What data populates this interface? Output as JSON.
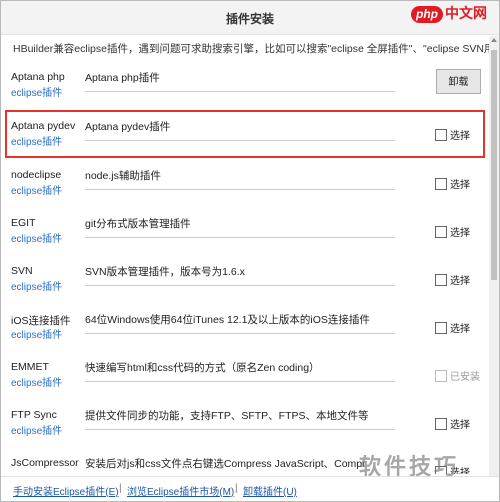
{
  "window": {
    "title": "插件安装"
  },
  "watermark_top": {
    "logo": "php",
    "text": "中文网"
  },
  "description": "HBuilder兼容eclipse插件，遇到问题可求助搜索引擎，比如可以搜索\"eclipse 全屏插件\"、\"eclipse SVN用法\"",
  "plugins": [
    {
      "name": "Aptana php",
      "link": "eclipse插件",
      "desc": "Aptana php插件",
      "action": "button",
      "action_label": "卸载"
    },
    {
      "name": "Aptana pydev",
      "link": "eclipse插件",
      "desc": "Aptana pydev插件",
      "action": "checkbox",
      "action_label": "选择",
      "highlighted": true
    },
    {
      "name": "nodeclipse",
      "link": "eclipse插件",
      "desc": "node.js辅助插件",
      "action": "checkbox",
      "action_label": "选择"
    },
    {
      "name": "EGIT",
      "link": "eclipse插件",
      "desc": "git分布式版本管理插件",
      "action": "checkbox",
      "action_label": "选择"
    },
    {
      "name": "SVN",
      "link": "eclipse插件",
      "desc": "SVN版本管理插件，版本号为1.6.x",
      "action": "checkbox",
      "action_label": "选择"
    },
    {
      "name": "iOS连接插件",
      "link": "eclipse插件",
      "desc": "64位Windows使用64位iTunes 12.1及以上版本的iOS连接插件",
      "action": "checkbox",
      "action_label": "选择"
    },
    {
      "name": "EMMET",
      "link": "eclipse插件",
      "desc": "快速编写html和css代码的方式（原名Zen coding）",
      "action": "checkbox-disabled",
      "action_label": "已安装"
    },
    {
      "name": "FTP Sync",
      "link": "eclipse插件",
      "desc": "提供文件同步的功能，支持FTP、SFTP、FTPS、本地文件等",
      "action": "checkbox",
      "action_label": "选择"
    },
    {
      "name": "JsCompressor",
      "link": "",
      "desc": "安装后对js和css文件点右键选Compress JavaScript、Compr",
      "action": "checkbox",
      "action_label": "选择"
    }
  ],
  "footer": {
    "links": [
      "手动安装Eclipse插件(E)",
      "浏览Eclipse插件市场(M)",
      "卸载插件(U)"
    ],
    "separator": "|"
  },
  "watermark_bottom": "软件技巧",
  "colors": {
    "link": "#2a6ec6",
    "highlight_border": "#e7322b"
  }
}
